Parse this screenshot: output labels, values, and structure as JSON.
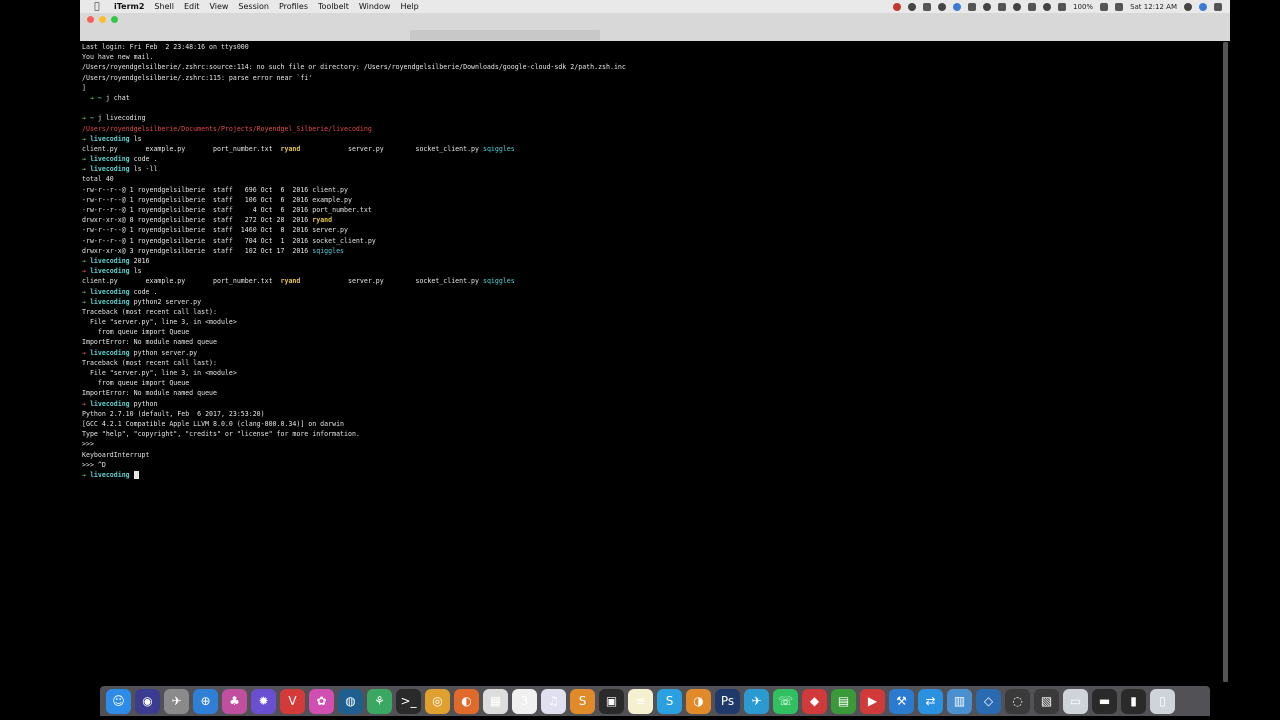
{
  "menubar": {
    "app_name": "iTerm2",
    "items": [
      "Shell",
      "Edit",
      "View",
      "Session",
      "Profiles",
      "Toolbelt",
      "Window",
      "Help"
    ],
    "battery": "100%",
    "clock": "Sat 12:12 AM"
  },
  "window": {
    "tab_label": "",
    "terminal_lines": [
      {
        "parts": [
          {
            "t": "Last login: Fri Feb  2 23:48:16 on ttys000",
            "c": "cmd"
          }
        ]
      },
      {
        "parts": [
          {
            "t": "You have new mail.",
            "c": "cmd"
          }
        ]
      },
      {
        "parts": [
          {
            "t": "/Users/royendgelsilberie/.zshrc:source:114: no such file or directory: /Users/royendgelsilberie/Downloads/google-cloud-sdk 2/path.zsh.inc",
            "c": "cmd"
          }
        ]
      },
      {
        "parts": [
          {
            "t": "/Users/royendgelsilberie/.zshrc:115: parse error near `fi'",
            "c": "cmd"
          }
        ]
      },
      {
        "parts": [
          {
            "t": "] ",
            "c": "cmd"
          }
        ]
      },
      {
        "parts": [
          {
            "t": "  → ",
            "c": "arrow"
          },
          {
            "t": "~ ",
            "c": "dir"
          },
          {
            "t": "j chat",
            "c": "cmd"
          }
        ]
      },
      {
        "parts": [
          {
            "t": "",
            "c": "cmd"
          }
        ]
      },
      {
        "parts": [
          {
            "t": "→ ",
            "c": "arrow"
          },
          {
            "t": "~ ",
            "c": "dir"
          },
          {
            "t": "j livecoding",
            "c": "cmd"
          }
        ]
      },
      {
        "parts": [
          {
            "t": "/Users/royendgelsilberie/Documents/Projects/Royendgel_Silberie/livecoding",
            "c": "red"
          }
        ]
      },
      {
        "parts": [
          {
            "t": "→ ",
            "c": "arrow"
          },
          {
            "t": "livecoding ",
            "c": "dir"
          },
          {
            "t": "ls",
            "c": "cmd"
          }
        ]
      },
      {
        "parts": [
          {
            "t": "client.py       example.py       port_number.txt  ",
            "c": "cmd"
          },
          {
            "t": "ryand",
            "c": "ydir"
          },
          {
            "t": "            server.py        socket_client.py ",
            "c": "cmd"
          },
          {
            "t": "sqiggles",
            "c": "cyan"
          }
        ]
      },
      {
        "parts": [
          {
            "t": "→ ",
            "c": "arrow"
          },
          {
            "t": "livecoding ",
            "c": "dir"
          },
          {
            "t": "code .",
            "c": "cmd"
          }
        ]
      },
      {
        "parts": [
          {
            "t": "→ ",
            "c": "arrow"
          },
          {
            "t": "livecoding ",
            "c": "dir"
          },
          {
            "t": "ls -ll",
            "c": "cmd"
          }
        ]
      },
      {
        "parts": [
          {
            "t": "total 40",
            "c": "cmd"
          }
        ]
      },
      {
        "parts": [
          {
            "t": "-rw-r--r--@ 1 royendgelsilberie  staff   696 Oct  6  2016 client.py",
            "c": "cmd"
          }
        ]
      },
      {
        "parts": [
          {
            "t": "-rw-r--r--@ 1 royendgelsilberie  staff   106 Oct  6  2016 example.py",
            "c": "cmd"
          }
        ]
      },
      {
        "parts": [
          {
            "t": "-rw-r--r--@ 1 royendgelsilberie  staff     4 Oct  6  2016 port_number.txt",
            "c": "cmd"
          }
        ]
      },
      {
        "parts": [
          {
            "t": "drwxr-xr-x@ 8 royendgelsilberie  staff   272 Oct 28  2016 ",
            "c": "cmd"
          },
          {
            "t": "ryand",
            "c": "ydir"
          }
        ]
      },
      {
        "parts": [
          {
            "t": "-rw-r--r--@ 1 royendgelsilberie  staff  1460 Oct  8  2016 server.py",
            "c": "cmd"
          }
        ]
      },
      {
        "parts": [
          {
            "t": "-rw-r--r--@ 1 royendgelsilberie  staff   704 Oct  1  2016 socket_client.py",
            "c": "cmd"
          }
        ]
      },
      {
        "parts": [
          {
            "t": "drwxr-xr-x@ 3 royendgelsilberie  staff   102 Oct 17  2016 ",
            "c": "cmd"
          },
          {
            "t": "sqiggles",
            "c": "cyan"
          }
        ]
      },
      {
        "parts": [
          {
            "t": "→ ",
            "c": "arrow"
          },
          {
            "t": "livecoding ",
            "c": "dir"
          },
          {
            "t": "2016",
            "c": "cmd"
          }
        ]
      },
      {
        "parts": [
          {
            "t": "→ ",
            "c": "arrow err"
          },
          {
            "t": "livecoding ",
            "c": "dir"
          },
          {
            "t": "ls",
            "c": "cmd"
          }
        ]
      },
      {
        "parts": [
          {
            "t": "client.py       example.py       port_number.txt  ",
            "c": "cmd"
          },
          {
            "t": "ryand",
            "c": "ydir"
          },
          {
            "t": "            server.py        socket_client.py ",
            "c": "cmd"
          },
          {
            "t": "sqiggles",
            "c": "cyan"
          }
        ]
      },
      {
        "parts": [
          {
            "t": "→ ",
            "c": "arrow"
          },
          {
            "t": "livecoding ",
            "c": "dir"
          },
          {
            "t": "code .",
            "c": "cmd"
          }
        ]
      },
      {
        "parts": [
          {
            "t": "→ ",
            "c": "arrow"
          },
          {
            "t": "livecoding ",
            "c": "dir"
          },
          {
            "t": "python2 server.py",
            "c": "cmd"
          }
        ]
      },
      {
        "parts": [
          {
            "t": "Traceback (most recent call last):",
            "c": "cmd"
          }
        ]
      },
      {
        "parts": [
          {
            "t": "  File \"server.py\", line 3, in <module>",
            "c": "cmd"
          }
        ]
      },
      {
        "parts": [
          {
            "t": "    from queue import Queue",
            "c": "cmd"
          }
        ]
      },
      {
        "parts": [
          {
            "t": "ImportError: No module named queue",
            "c": "cmd"
          }
        ]
      },
      {
        "parts": [
          {
            "t": "→ ",
            "c": "arrow err"
          },
          {
            "t": "livecoding ",
            "c": "dir"
          },
          {
            "t": "python server.py",
            "c": "cmd"
          }
        ]
      },
      {
        "parts": [
          {
            "t": "Traceback (most recent call last):",
            "c": "cmd"
          }
        ]
      },
      {
        "parts": [
          {
            "t": "  File \"server.py\", line 3, in <module>",
            "c": "cmd"
          }
        ]
      },
      {
        "parts": [
          {
            "t": "    from queue import Queue",
            "c": "cmd"
          }
        ]
      },
      {
        "parts": [
          {
            "t": "ImportError: No module named queue",
            "c": "cmd"
          }
        ]
      },
      {
        "parts": [
          {
            "t": "→ ",
            "c": "arrow err"
          },
          {
            "t": "livecoding ",
            "c": "dir"
          },
          {
            "t": "python",
            "c": "cmd"
          }
        ]
      },
      {
        "parts": [
          {
            "t": "Python 2.7.10 (default, Feb  6 2017, 23:53:20)",
            "c": "cmd"
          }
        ]
      },
      {
        "parts": [
          {
            "t": "[GCC 4.2.1 Compatible Apple LLVM 8.0.0 (clang-800.0.34)] on darwin",
            "c": "cmd"
          }
        ]
      },
      {
        "parts": [
          {
            "t": "Type \"help\", \"copyright\", \"credits\" or \"license\" for more information.",
            "c": "cmd"
          }
        ]
      },
      {
        "parts": [
          {
            "t": ">>>",
            "c": "cmd"
          }
        ]
      },
      {
        "parts": [
          {
            "t": "KeyboardInterrupt",
            "c": "cmd"
          }
        ]
      },
      {
        "parts": [
          {
            "t": ">>> ^D",
            "c": "cmd"
          }
        ]
      },
      {
        "parts": [
          {
            "t": "→ ",
            "c": "arrow"
          },
          {
            "t": "livecoding ",
            "c": "dir"
          }
        ],
        "cursor": true
      }
    ]
  },
  "dock": {
    "icons": [
      {
        "name": "finder-icon",
        "glyph": "☺",
        "color": "#2d8ce8"
      },
      {
        "name": "siri-icon",
        "glyph": "◉",
        "color": "#3b3b8f"
      },
      {
        "name": "launchpad-icon",
        "glyph": "✈",
        "color": "#8a8a8a"
      },
      {
        "name": "safari-icon",
        "glyph": "⊕",
        "color": "#2f7fd6"
      },
      {
        "name": "app-icon-1",
        "glyph": "♣",
        "color": "#c04fa0"
      },
      {
        "name": "app-icon-2",
        "glyph": "✹",
        "color": "#6a4fd0"
      },
      {
        "name": "vivaldi-icon",
        "glyph": "V",
        "color": "#d43a3a"
      },
      {
        "name": "app-icon-3",
        "glyph": "✿",
        "color": "#d04fb0"
      },
      {
        "name": "app-icon-4",
        "glyph": "◍",
        "color": "#1f5f8f"
      },
      {
        "name": "app-icon-5",
        "glyph": "⚘",
        "color": "#3aa860"
      },
      {
        "name": "terminal-icon",
        "glyph": ">_",
        "color": "#2a2a2a"
      },
      {
        "name": "chrome-icon",
        "glyph": "◎",
        "color": "#e0a030"
      },
      {
        "name": "firefox-icon",
        "glyph": "◐",
        "color": "#e06a2a"
      },
      {
        "name": "calendar-grid-icon",
        "glyph": "▦",
        "color": "#dddddd"
      },
      {
        "name": "calendar-icon",
        "glyph": "3",
        "color": "#f0f0f0"
      },
      {
        "name": "itunes-icon",
        "glyph": "♫",
        "color": "#e0e0f0"
      },
      {
        "name": "sublime-icon",
        "glyph": "S",
        "color": "#e08a2a"
      },
      {
        "name": "app-icon-6",
        "glyph": "▣",
        "color": "#2a2a2a"
      },
      {
        "name": "notes-icon",
        "glyph": "≡",
        "color": "#f5f0d0"
      },
      {
        "name": "skype-icon",
        "glyph": "S",
        "color": "#2aa0e0"
      },
      {
        "name": "app-icon-7",
        "glyph": "◑",
        "color": "#e08a2a"
      },
      {
        "name": "photoshop-icon",
        "glyph": "Ps",
        "color": "#1f3a6a"
      },
      {
        "name": "app-icon-8",
        "glyph": "✈",
        "color": "#2a9ad0"
      },
      {
        "name": "whatsapp-icon",
        "glyph": "☏",
        "color": "#30c060"
      },
      {
        "name": "app-icon-9",
        "glyph": "◆",
        "color": "#d03a3a"
      },
      {
        "name": "app-icon-10",
        "glyph": "▤",
        "color": "#3a9a3a"
      },
      {
        "name": "app-icon-11",
        "glyph": "▶",
        "color": "#d03a3a"
      },
      {
        "name": "xcode-icon",
        "glyph": "⚒",
        "color": "#2a7ad0"
      },
      {
        "name": "app-icon-12",
        "glyph": "⇄",
        "color": "#2a90e0"
      },
      {
        "name": "preview-icon",
        "glyph": "▥",
        "color": "#4a90d0"
      },
      {
        "name": "vscode-icon",
        "glyph": "◇",
        "color": "#2a6ab0"
      },
      {
        "name": "obs-icon",
        "glyph": "◌",
        "color": "#3a3a3a"
      },
      {
        "name": "app-icon-13",
        "glyph": "▧",
        "color": "#3a3a3a"
      },
      {
        "name": "folder-icon",
        "glyph": "▭",
        "color": "#cfd4da"
      },
      {
        "name": "app-icon-14",
        "glyph": "▬",
        "color": "#2a2a2a"
      },
      {
        "name": "downloads-icon",
        "glyph": "▮",
        "color": "#2a2a2a"
      },
      {
        "name": "trash-icon",
        "glyph": "▯",
        "color": "#cfd4da"
      }
    ]
  }
}
